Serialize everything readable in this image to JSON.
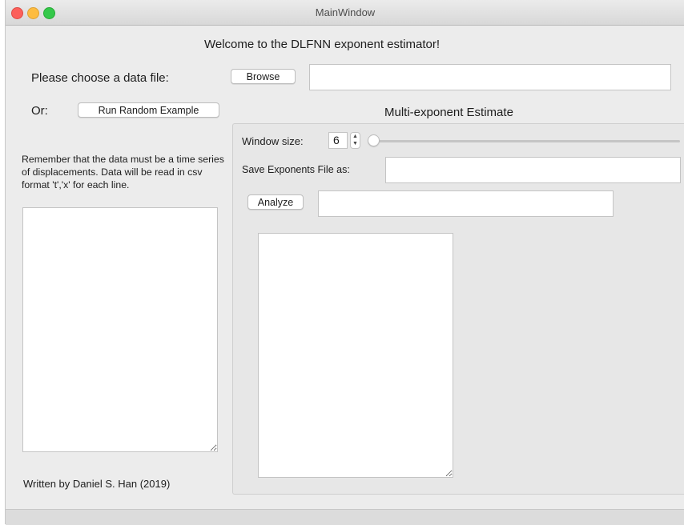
{
  "window": {
    "title": "MainWindow"
  },
  "header": {
    "welcome": "Welcome to the DLFNN exponent estimator!"
  },
  "file_chooser": {
    "label": "Please choose a data file:",
    "browse_label": "Browse",
    "path_value": ""
  },
  "random": {
    "or_label": "Or:",
    "button_label": "Run Random Example"
  },
  "note": {
    "text": "Remember that the data must be a time series of displacements. Data will be read in csv format 't','x' for each line."
  },
  "multi_exponent": {
    "title": "Multi-exponent Estimate",
    "window_size_label": "Window size:",
    "window_size_value": "6",
    "slider_fraction": 0.0,
    "save_label": "Save Exponents File as:",
    "save_value": "",
    "analyze_label": "Analyze",
    "analyze_value": ""
  },
  "footer": {
    "credit": "Written by Daniel S. Han (2019)"
  },
  "colors": {
    "close": "#fc605b",
    "minimize": "#fdbc40",
    "maximize": "#34c84a",
    "window_bg": "#ececec"
  },
  "icons": {
    "spinner": "up-down-chevron-icon"
  }
}
